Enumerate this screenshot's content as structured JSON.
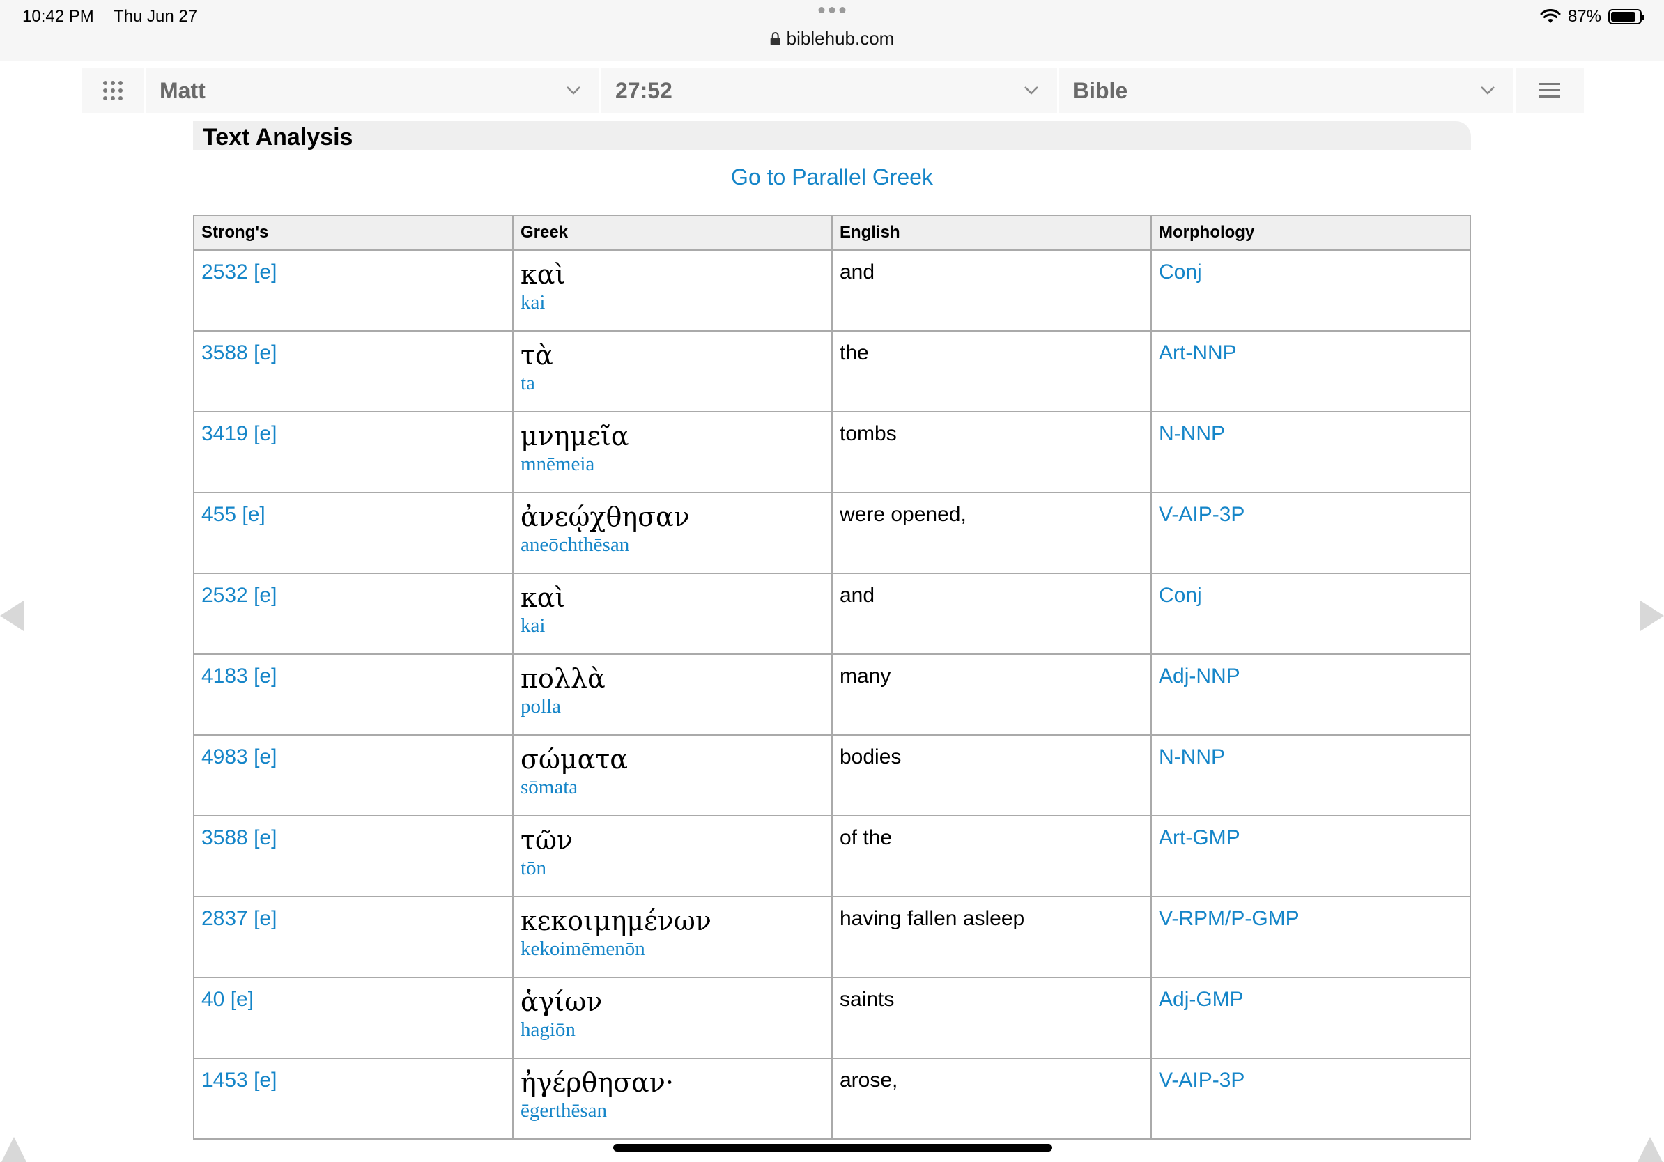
{
  "status": {
    "time": "10:42 PM",
    "date": "Thu Jun 27",
    "battery": "87%",
    "battery_level": 0.87,
    "wifi_icon": "wifi-icon",
    "url": "biblehub.com"
  },
  "nav": {
    "book": "Matt",
    "verse": "27:52",
    "version": "Bible"
  },
  "section_title": "Text Analysis",
  "parallel_link": "Go to Parallel Greek",
  "table": {
    "headers": [
      "Strong's",
      "Greek",
      "English",
      "Morphology"
    ],
    "rows": [
      {
        "strongs": "2532 [e]",
        "greek": "καὶ",
        "translit": "kai",
        "english": "and",
        "morph": "Conj"
      },
      {
        "strongs": "3588 [e]",
        "greek": "τὰ",
        "translit": "ta",
        "english": "the",
        "morph": "Art-NNP"
      },
      {
        "strongs": "3419 [e]",
        "greek": "μνημεῖα",
        "translit": "mnēmeia",
        "english": "tombs",
        "morph": "N-NNP"
      },
      {
        "strongs": "455 [e]",
        "greek": "ἀνεῴχθησαν",
        "translit": "aneōchthēsan",
        "english": "were opened,",
        "morph": "V-AIP-3P"
      },
      {
        "strongs": "2532 [e]",
        "greek": "καὶ",
        "translit": "kai",
        "english": "and",
        "morph": "Conj"
      },
      {
        "strongs": "4183 [e]",
        "greek": "πολλὰ",
        "translit": "polla",
        "english": "many",
        "morph": "Adj-NNP"
      },
      {
        "strongs": "4983 [e]",
        "greek": "σώματα",
        "translit": "sōmata",
        "english": "bodies",
        "morph": "N-NNP"
      },
      {
        "strongs": "3588 [e]",
        "greek": "τῶν",
        "translit": "tōn",
        "english": "of the",
        "morph": "Art-GMP"
      },
      {
        "strongs": "2837 [e]",
        "greek": "κεκοιμημένων",
        "translit": "kekoimēmenōn",
        "english": "having fallen asleep",
        "morph": "V-RPM/P-GMP"
      },
      {
        "strongs": "40 [e]",
        "greek": "ἁγίων",
        "translit": "hagiōn",
        "english": "saints",
        "morph": "Adj-GMP"
      },
      {
        "strongs": "1453 [e]",
        "greek": "ἠγέρθησαν·",
        "translit": "ēgerthēsan",
        "english": "arose,",
        "morph": "V-AIP-3P"
      }
    ]
  },
  "colors": {
    "link": "#1585c8",
    "header_bg": "#efefef",
    "border": "#aaaaaa"
  }
}
